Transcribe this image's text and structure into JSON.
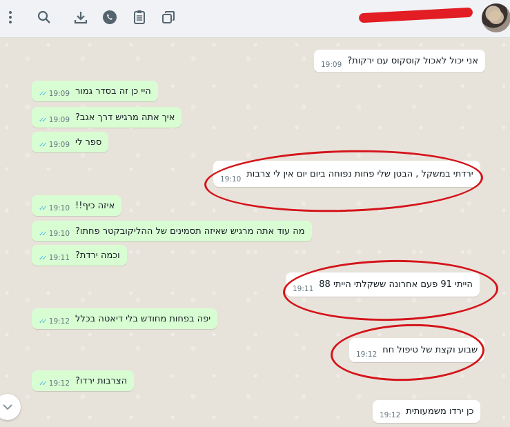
{
  "header": {
    "contact_name": "",
    "icons": [
      "more-vert-icon",
      "search-icon",
      "download-icon",
      "whatsapp-icon",
      "clipboard-icon",
      "copy-icon"
    ]
  },
  "messages": [
    {
      "dir": "in",
      "text": "אני יכול לאכול קוסקוס עם ירקות?",
      "time": "19:09"
    },
    {
      "dir": "out",
      "text": "היי כן זה בסדר גמור",
      "time": "19:09"
    },
    {
      "dir": "out",
      "text": "איך אתה מרגיש דרך אגב?",
      "time": "19:09"
    },
    {
      "dir": "out",
      "text": "ספר לי",
      "time": "19:09"
    },
    {
      "dir": "in",
      "text": "ירדתי במשקל , הבטן שלי פחות נפוחה ביום יום אין לי צרבות",
      "time": "19:10"
    },
    {
      "dir": "out",
      "text": "איזה כיף!!",
      "time": "19:10"
    },
    {
      "dir": "out",
      "text": "מה עוד אתה מרגיש שאיזה תסמינים של ההליקובקטר פחתו?",
      "time": "19:10"
    },
    {
      "dir": "out",
      "text": "וכמה ירדת?",
      "time": "19:11"
    },
    {
      "dir": "in",
      "text": "הייתי 91 פעם אחרונה ששקלתי הייתי 88",
      "time": "19:11"
    },
    {
      "dir": "out",
      "text": "יפה בפחות מחודש בלי דיאטה בכלל",
      "time": "19:12"
    },
    {
      "dir": "in",
      "text": "שבוע וקצת של טיפול חח",
      "time": "19:12"
    },
    {
      "dir": "out",
      "text": "הצרבות ירדו?",
      "time": "19:12"
    },
    {
      "dir": "in",
      "text": "כן ירדו משמעותית",
      "time": "19:12"
    }
  ],
  "colors": {
    "outgoing_bubble": "#d9fdd3",
    "incoming_bubble": "#ffffff",
    "read_ticks": "#53bdeb",
    "annotation_circle": "#d4141b"
  }
}
